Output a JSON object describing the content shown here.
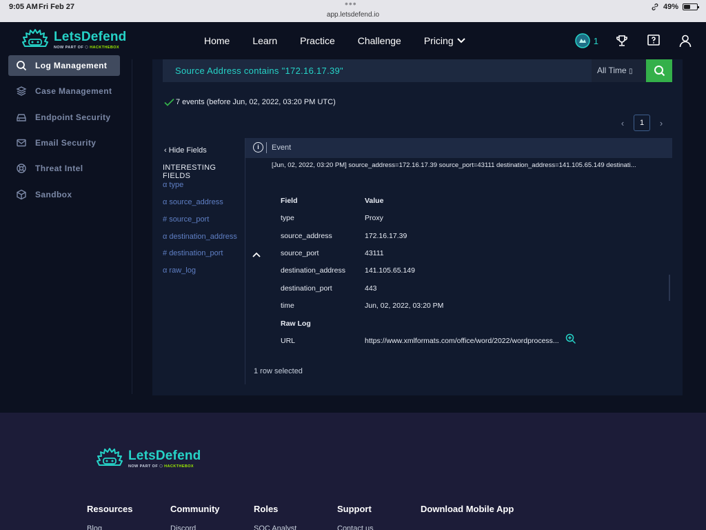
{
  "status": {
    "time": "9:05 AM",
    "date": "Fri Feb 27",
    "url": "app.letsdefend.io",
    "battery": "49%"
  },
  "brand": {
    "name": "LetsDefend",
    "sub_prefix": "NOW PART OF",
    "sub_brand": "HACKTHEBOX"
  },
  "nav": {
    "items": [
      "Home",
      "Learn",
      "Practice",
      "Challenge",
      "Pricing"
    ],
    "notification_count": "1"
  },
  "sidebar": {
    "items": [
      {
        "label": "Log Management",
        "icon": "search-icon",
        "active": true
      },
      {
        "label": "Case Management",
        "icon": "layers-icon"
      },
      {
        "label": "Endpoint Security",
        "icon": "drive-icon"
      },
      {
        "label": "Email Security",
        "icon": "mail-icon"
      },
      {
        "label": "Threat Intel",
        "icon": "lifebuoy-icon"
      },
      {
        "label": "Sandbox",
        "icon": "cube-icon"
      }
    ]
  },
  "search": {
    "query": "Source Address contains \"172.16.17.39\"",
    "time_range": "All Time"
  },
  "results": {
    "summary": "7 events (before Jun, 02, 2022, 03:20 PM UTC)",
    "page": "1",
    "hide_fields": "Hide Fields",
    "interesting_title": "INTERESTING FIELDS",
    "fields": [
      {
        "type": "α",
        "name": "type"
      },
      {
        "type": "α",
        "name": "source_address"
      },
      {
        "type": "#",
        "name": "source_port"
      },
      {
        "type": "α",
        "name": "destination_address"
      },
      {
        "type": "#",
        "name": "destination_port"
      },
      {
        "type": "α",
        "name": "raw_log"
      }
    ],
    "event_column": "Event",
    "raw_event": "[Jun, 02, 2022, 03:20 PM] source_address=172.16.17.39 source_port=43111 destination_address=141.105.65.149 destinati...",
    "table_header": {
      "field": "Field",
      "value": "Value"
    },
    "rows": [
      {
        "field": "type",
        "value": "Proxy"
      },
      {
        "field": "source_address",
        "value": "172.16.17.39"
      },
      {
        "field": "source_port",
        "value": "43111"
      },
      {
        "field": "destination_address",
        "value": "141.105.65.149"
      },
      {
        "field": "destination_port",
        "value": "443"
      },
      {
        "field": "time",
        "value": "Jun, 02, 2022, 03:20 PM"
      }
    ],
    "raw_log_label": "Raw Log",
    "url_row": {
      "field": "URL",
      "value": "https://www.xmlformats.com/office/word/2022/wordprocess..."
    },
    "selection": "1 row selected"
  },
  "footer": {
    "columns": [
      "Resources",
      "Community",
      "Roles",
      "Support",
      "Download Mobile App"
    ],
    "sub_items": [
      "Blog",
      "Discord",
      "SOC Analyst",
      "Contact us"
    ]
  },
  "colors": {
    "accent": "#26d3c7",
    "search_button": "#34b04a",
    "field_link": "#5f7fc4",
    "background": "#0c1120",
    "footer": "#1c1c38"
  }
}
